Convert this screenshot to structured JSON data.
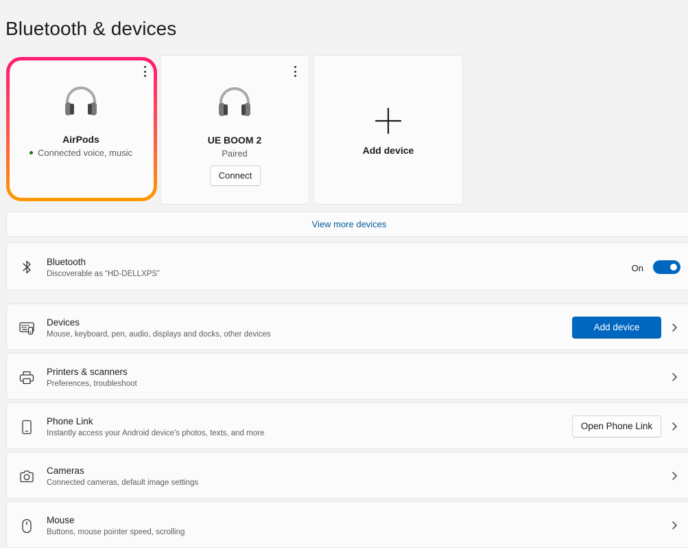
{
  "page": {
    "title": "Bluetooth & devices"
  },
  "tiles": [
    {
      "name": "AirPods",
      "status": "Connected voice, music",
      "status_color": "#0f7b0f",
      "icon": "headphones-icon",
      "highlighted": true
    },
    {
      "name": "UE BOOM 2",
      "status": "Paired",
      "action_label": "Connect",
      "icon": "headphones-icon"
    },
    {
      "label": "Add device",
      "icon": "plus-icon"
    }
  ],
  "view_more": {
    "label": "View more devices"
  },
  "bluetooth": {
    "title": "Bluetooth",
    "subtitle": "Discoverable as “HD-DELLXPS”",
    "toggle_label": "On",
    "toggle_on": true,
    "icon": "bluetooth-icon"
  },
  "settings": [
    {
      "title": "Devices",
      "subtitle": "Mouse, keyboard, pen, audio, displays and docks, other devices",
      "button": "Add device",
      "icon": "keyboard-devices-icon"
    },
    {
      "title": "Printers & scanners",
      "subtitle": "Preferences, troubleshoot",
      "icon": "printer-icon"
    },
    {
      "title": "Phone Link",
      "subtitle": "Instantly access your Android device's photos, texts, and more",
      "button": "Open Phone Link",
      "icon": "phone-icon"
    },
    {
      "title": "Cameras",
      "subtitle": "Connected cameras, default image settings",
      "icon": "camera-icon"
    },
    {
      "title": "Mouse",
      "subtitle": "Buttons, mouse pointer speed, scrolling",
      "icon": "mouse-icon"
    }
  ],
  "colors": {
    "accent": "#0067c0",
    "link": "#005a9e",
    "background": "#f3f3f3",
    "card": "#fbfbfb",
    "highlight_top": "#ff1a72",
    "highlight_bottom": "#ff9a00"
  }
}
